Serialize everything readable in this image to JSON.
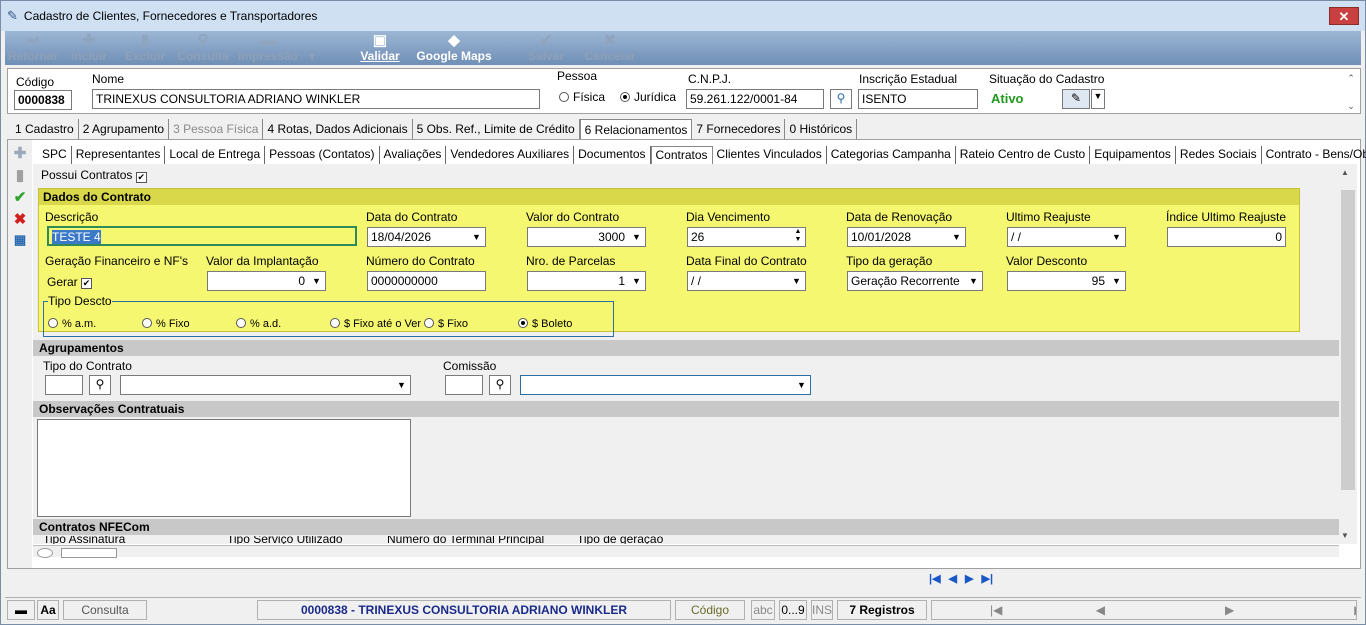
{
  "window": {
    "title": "Cadastro de Clientes, Fornecedores e Transportadores",
    "close": "✕"
  },
  "toolbar": [
    {
      "label": "Retornar",
      "icon": "↩",
      "enabled": false
    },
    {
      "label": "Incluir",
      "icon": "✚",
      "enabled": false
    },
    {
      "label": "Excluir",
      "icon": "▮",
      "enabled": false
    },
    {
      "label": "Consulta",
      "icon": "⚲",
      "enabled": false
    },
    {
      "label": "Impressão",
      "icon": "▬",
      "enabled": false
    },
    {
      "label": "▾",
      "icon": "",
      "enabled": false
    },
    {
      "label": "Validar",
      "icon": "▣",
      "enabled": true
    },
    {
      "label": "Google Maps",
      "icon": "◆",
      "enabled": true
    },
    {
      "label": "Salvar",
      "icon": "✔",
      "enabled": false
    },
    {
      "label": "Cancelar",
      "icon": "✖",
      "enabled": false
    }
  ],
  "header": {
    "codigo_label": "Código",
    "codigo": "0000838",
    "nome_label": "Nome",
    "nome": "TRINEXUS CONSULTORIA ADRIANO WINKLER",
    "pessoa_label": "Pessoa",
    "fisica": "Física",
    "juridica": "Jurídica",
    "cnpj_label": "C.N.P.J.",
    "cnpj": "59.261.122/0001-84",
    "ie_label": "Inscrição Estadual",
    "ie": "ISENTO",
    "situacao_label": "Situação do Cadastro",
    "situacao": "Ativo"
  },
  "tabs1": [
    {
      "label": "1 Cadastro",
      "state": ""
    },
    {
      "label": "2 Agrupamento",
      "state": ""
    },
    {
      "label": "3 Pessoa Física",
      "state": "dis"
    },
    {
      "label": "4 Rotas, Dados Adicionais",
      "state": ""
    },
    {
      "label": "5 Obs. Ref., Limite de Crédito",
      "state": ""
    },
    {
      "label": "6 Relacionamentos",
      "state": "act"
    },
    {
      "label": "7 Fornecedores",
      "state": ""
    },
    {
      "label": "0 Históricos",
      "state": ""
    }
  ],
  "tabs2": [
    "SPC",
    "Representantes",
    "Local de Entrega",
    "Pessoas (Contatos)",
    "Avaliações",
    "Vendedores Auxiliares",
    "Documentos",
    "Contratos",
    "Clientes Vinculados",
    "Categorias Campanha",
    "Rateio Centro de Custo",
    "Equipamentos",
    "Redes Sociais",
    "Contrato - Bens/Obras"
  ],
  "active_tab2": "Contratos",
  "possui_contratos": "Possui Contratos",
  "dados": {
    "title": "Dados do Contrato",
    "descricao_label": "Descrição",
    "descricao": "TESTE 4",
    "data_contrato_label": "Data do Contrato",
    "data_contrato": "18/04/2026",
    "valor_contrato_label": "Valor do Contrato",
    "valor_contrato": "3000",
    "dia_venc_label": "Dia Vencimento",
    "dia_venc": "26",
    "data_renov_label": "Data de Renovação",
    "data_renov": "10/01/2028",
    "ult_reajuste_label": "Ultimo Reajuste",
    "ult_reajuste": " /  /",
    "indice_label": "Índice Ultimo Reajuste",
    "indice": "0",
    "geracao_label": "Geração Financeiro e NF's",
    "gerar": "Gerar",
    "valor_impl_label": "Valor da Implantação",
    "valor_impl": "0",
    "numero_label": "Número do Contrato",
    "numero": "0000000000",
    "parcelas_label": "Nro. de Parcelas",
    "parcelas": "1",
    "data_final_label": "Data Final do Contrato",
    "data_final": " /  /",
    "tipo_geracao_label": "Tipo da geração",
    "tipo_geracao": "Geração Recorrente",
    "valor_desc_label": "Valor Desconto",
    "valor_desc": "95",
    "tipo_desc_label": "Tipo Descto",
    "tipo_desc": [
      "% a.m.",
      "% Fixo",
      "% a.d.",
      "$ Fixo até o Ver",
      "$ Fixo",
      "$ Boleto"
    ],
    "tipo_desc_selected": 5
  },
  "agrupamentos": {
    "title": "Agrupamentos",
    "tipo_label": "Tipo do Contrato",
    "comissao_label": "Comissão"
  },
  "observacoes": {
    "title": "Observações Contratuais"
  },
  "nfecom": {
    "title": "Contratos NFECom",
    "cols": [
      "Tipo Assinatura",
      "Tipo Serviço Utilizado",
      "Número do Terminal Principal",
      "Tipo de geração"
    ]
  },
  "nav": [
    "|◀",
    "◀",
    "▶",
    "▶|"
  ],
  "status": {
    "modo": "Consulta",
    "registro": "0000838 - TRINEXUS CONSULTORIA ADRIANO WINKLER",
    "ordem": "Código",
    "abc": "abc",
    "num": "0...9",
    "ins": "INS",
    "registros": "7 Registros",
    "aa": "Aa"
  },
  "colors": {
    "toolbar": "#6f8fb6",
    "yellow": "#f6f771",
    "ativo": "#1f9a1f"
  }
}
